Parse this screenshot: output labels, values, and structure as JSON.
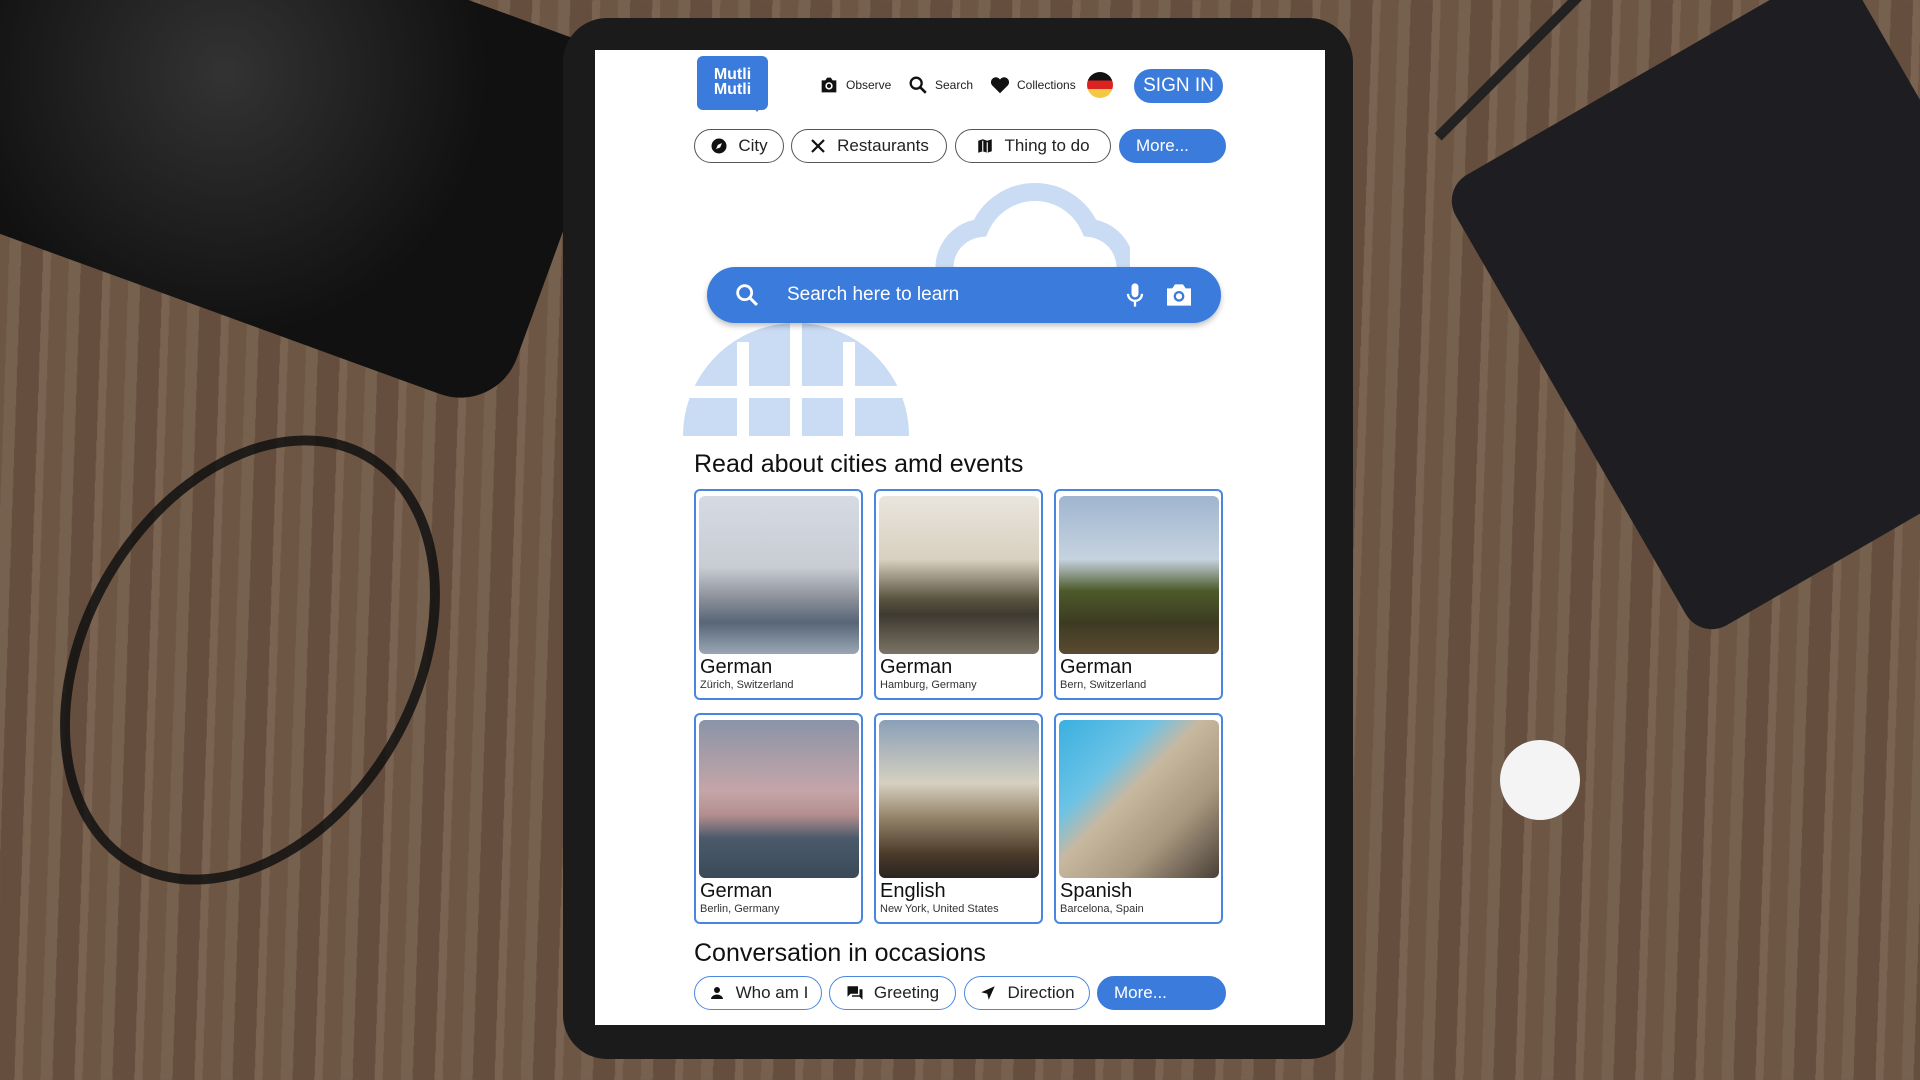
{
  "app": {
    "logo": "Mutli Mutli",
    "logo_line1": "Mutli",
    "logo_line2": "Mutli"
  },
  "nav": {
    "observe": "Observe",
    "search": "Search",
    "collections": "Collections",
    "sign_in": "SIGN IN",
    "language_flag": "germany-flag"
  },
  "categories": [
    {
      "label": "City",
      "icon": "compass-icon"
    },
    {
      "label": "Restaurants",
      "icon": "utensils-icon"
    },
    {
      "label": "Thing to do",
      "icon": "map-icon"
    },
    {
      "label": "More..."
    }
  ],
  "search": {
    "placeholder": "Search here to learn"
  },
  "cities_section": {
    "title": "Read about cities amd events",
    "cards": [
      {
        "language": "German",
        "city": "Zürich, Switzerland"
      },
      {
        "language": "German",
        "city": "Hamburg, Germany"
      },
      {
        "language": "German",
        "city": "Bern, Switzerland"
      },
      {
        "language": "German",
        "city": "Berlin, Germany"
      },
      {
        "language": "English",
        "city": "New York, United States"
      },
      {
        "language": "Spanish",
        "city": "Barcelona, Spain"
      }
    ]
  },
  "conversation_section": {
    "title": "Conversation in occasions",
    "chips": [
      {
        "label": "Who am I",
        "icon": "person-icon"
      },
      {
        "label": "Greeting",
        "icon": "chat-icon"
      },
      {
        "label": "Direction",
        "icon": "navigation-arrow-icon"
      },
      {
        "label": "More..."
      }
    ]
  },
  "colors": {
    "accent": "#3a7bdc",
    "background_art": "#c9dcf3"
  }
}
